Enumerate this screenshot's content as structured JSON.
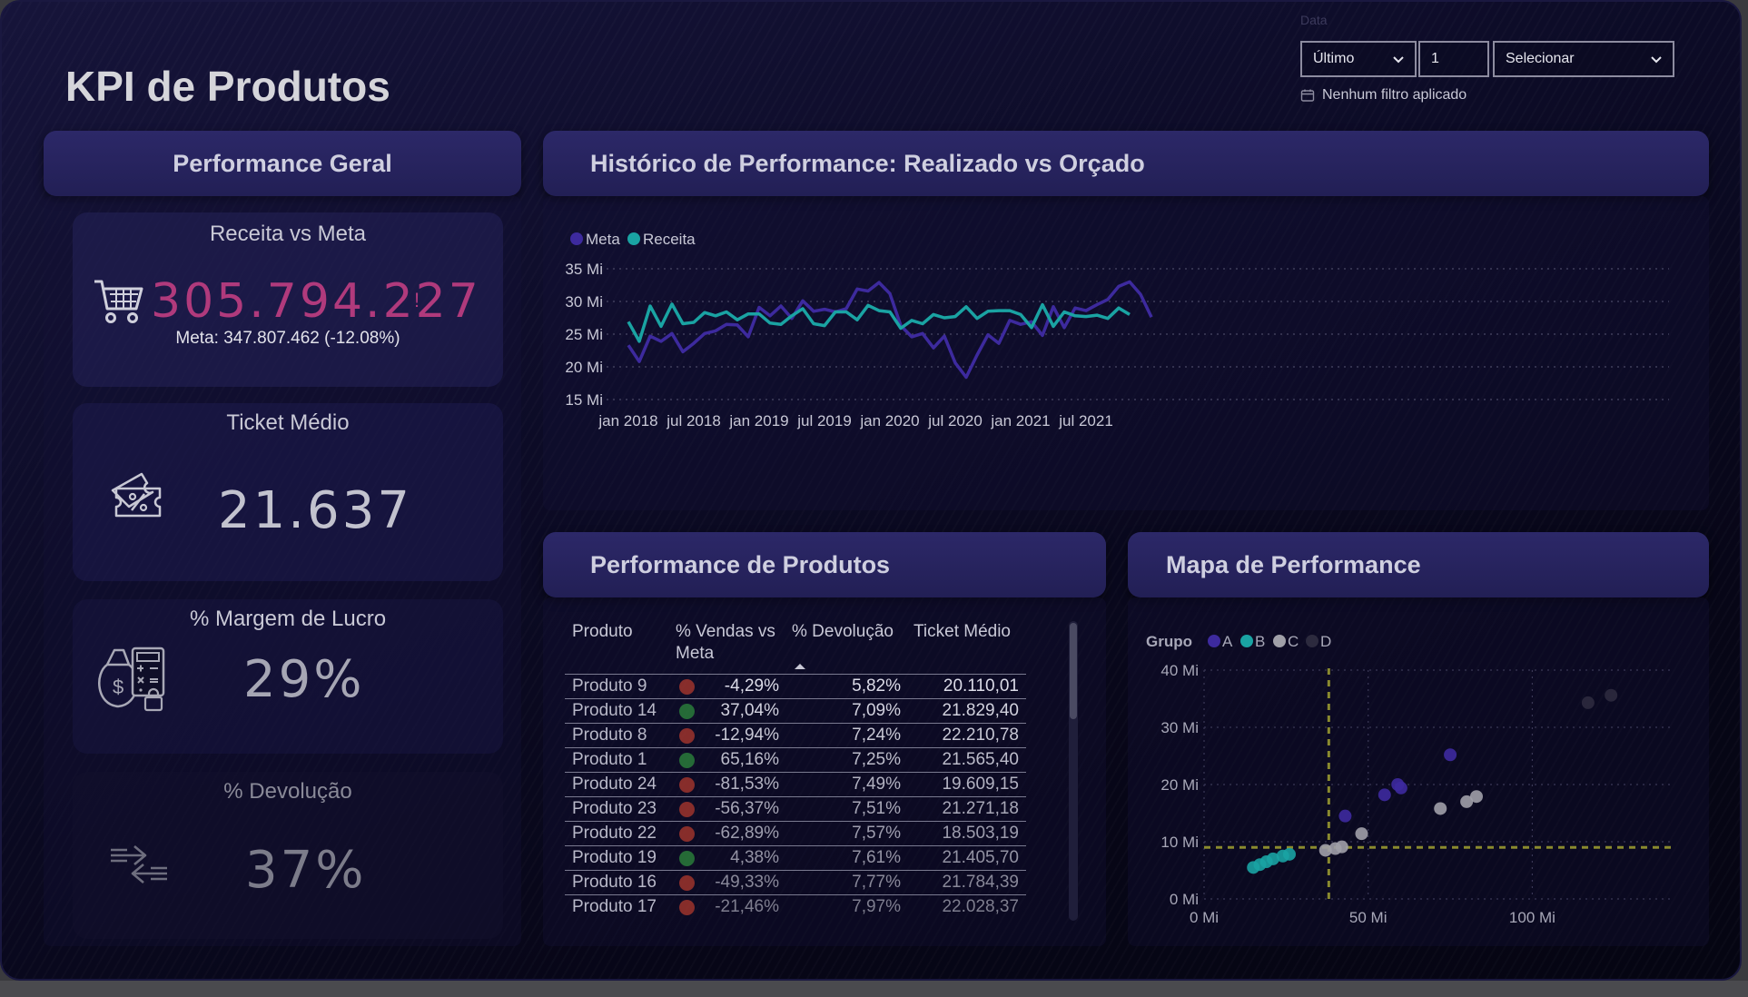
{
  "page_title": "KPI de Produtos",
  "filter": {
    "hint": "Data",
    "mode": "Último",
    "count": "1",
    "unit_placeholder": "Selecionar",
    "status": "Nenhum filtro aplicado"
  },
  "performance_geral": {
    "title": "Performance Geral",
    "receita": {
      "title": "Receita vs Meta",
      "value": "305.794.227",
      "alert": "!",
      "meta": "Meta: 347.807.462 (-12.08%)",
      "icon": "shopping-cart-icon",
      "value_color": "#b03a7c"
    },
    "ticket": {
      "title": "Ticket Médio",
      "value": "21.637",
      "icon": "discount-ticket-icon"
    },
    "margem": {
      "title": "% Margem de Lucro",
      "value": "29%",
      "icon": "money-bag-calculator-icon"
    },
    "devolucao": {
      "title": "% Devolução",
      "value": "37%",
      "icon": "exchange-arrows-icon"
    }
  },
  "historico": {
    "title": "Histórico de Performance: Realizado vs Orçado",
    "chart_data": {
      "type": "line",
      "legend_position": "top-left",
      "x_tick_labels": [
        "jan 2018",
        "jul 2018",
        "jan 2019",
        "jul 2019",
        "jan 2020",
        "jul 2020",
        "jan 2021",
        "jul 2021"
      ],
      "y_tick_labels": [
        "35 Mi",
        "30 Mi",
        "25 Mi",
        "20 Mi",
        "15 Mi"
      ],
      "ylim": [
        15,
        35
      ],
      "grid": true,
      "x_start": "jan 2018",
      "x_interval": "month",
      "series": [
        {
          "name": "Meta",
          "color": "#3d2a9e",
          "values": [
            23.3,
            20.8,
            24.7,
            23.9,
            25.1,
            22.3,
            23.6,
            25.1,
            25.5,
            26.5,
            26.4,
            24.6,
            29.1,
            27.8,
            29.3,
            27.4,
            30.1,
            28.5,
            28.8,
            28.4,
            28.9,
            31.9,
            31.6,
            32.9,
            31.2,
            26.3,
            24.6,
            25.1,
            22.9,
            24.7,
            20.6,
            18.4,
            21.8,
            24.9,
            23.6,
            27.1,
            26.5,
            26.9,
            24.8,
            29.2,
            26.0,
            29.0,
            28.6,
            29.5,
            30.3,
            32.3,
            33.0,
            31.1,
            27.6
          ]
        },
        {
          "name": "Receita",
          "color": "#1aa3a3",
          "values": [
            26.9,
            23.9,
            29.3,
            26.2,
            29.6,
            26.6,
            26.8,
            28.3,
            27.8,
            28.4,
            27.2,
            28.1,
            28.1,
            26.7,
            26.5,
            27.8,
            28.9,
            26.6,
            26.3,
            28.4,
            28.4,
            27.2,
            29.4,
            28.6,
            28.4,
            25.9,
            27.1,
            26.6,
            28.0,
            27.5,
            27.7,
            29.2,
            27.4,
            28.5,
            28.6,
            28.6,
            28.0,
            26.0,
            29.5,
            26.2,
            28.4,
            27.8,
            27.7,
            27.9,
            27.4,
            29.0,
            28.0
          ]
        }
      ]
    }
  },
  "produtos": {
    "title": "Performance de Produtos",
    "columns": [
      "Produto",
      "% Vendas vs Meta",
      "% Devolução",
      "Ticket Médio"
    ],
    "rows": [
      {
        "produto": "Produto 9",
        "status": "#b03a2e",
        "vendas": "-4,29%",
        "devolucao": "5,82%",
        "ticket": "20.110,01"
      },
      {
        "produto": "Produto 14",
        "status": "#2e8b3e",
        "vendas": "37,04%",
        "devolucao": "7,09%",
        "ticket": "21.829,40"
      },
      {
        "produto": "Produto 8",
        "status": "#b03a2e",
        "vendas": "-12,94%",
        "devolucao": "7,24%",
        "ticket": "22.210,78"
      },
      {
        "produto": "Produto 1",
        "status": "#2e8b3e",
        "vendas": "65,16%",
        "devolucao": "7,25%",
        "ticket": "21.565,40"
      },
      {
        "produto": "Produto 24",
        "status": "#b03a2e",
        "vendas": "-81,53%",
        "devolucao": "7,49%",
        "ticket": "19.609,15"
      },
      {
        "produto": "Produto 23",
        "status": "#b03a2e",
        "vendas": "-56,37%",
        "devolucao": "7,51%",
        "ticket": "21.271,18"
      },
      {
        "produto": "Produto 22",
        "status": "#b03a2e",
        "vendas": "-62,89%",
        "devolucao": "7,57%",
        "ticket": "18.503,19"
      },
      {
        "produto": "Produto 19",
        "status": "#2e8b3e",
        "vendas": "4,38%",
        "devolucao": "7,61%",
        "ticket": "21.405,70"
      },
      {
        "produto": "Produto 16",
        "status": "#b03a2e",
        "vendas": "-49,33%",
        "devolucao": "7,77%",
        "ticket": "21.784,39"
      },
      {
        "produto": "Produto 17",
        "status": "#b03a2e",
        "vendas": "-21,46%",
        "devolucao": "7,97%",
        "ticket": "22.028,37"
      }
    ]
  },
  "mapa": {
    "title": "Mapa de Performance",
    "chart_data": {
      "type": "scatter",
      "legend_title": "Grupo",
      "legend_position": "top-left",
      "x_tick_labels": [
        "0 Mi",
        "50 Mi",
        "100 Mi"
      ],
      "y_tick_labels": [
        "40 Mi",
        "30 Mi",
        "20 Mi",
        "10 Mi",
        "0 Mi"
      ],
      "xlim": [
        0,
        140
      ],
      "ylim": [
        0,
        40
      ],
      "reference_lines": {
        "x": 38,
        "y": 9
      },
      "series": [
        {
          "name": "A",
          "color": "#3d2a9e",
          "points": [
            [
              43,
              14.5
            ],
            [
              55,
              18.2
            ],
            [
              59,
              20.0
            ],
            [
              60,
              19.4
            ],
            [
              75,
              25.2
            ]
          ]
        },
        {
          "name": "B",
          "color": "#1aa3a3",
          "points": [
            [
              15,
              5.5
            ],
            [
              17,
              6.0
            ],
            [
              19,
              6.5
            ],
            [
              21,
              7.0
            ],
            [
              24,
              7.5
            ],
            [
              26,
              7.8
            ]
          ]
        },
        {
          "name": "C",
          "color": "#a0a0a8",
          "points": [
            [
              37,
              8.5
            ],
            [
              40,
              8.8
            ],
            [
              42,
              9.1
            ],
            [
              48,
              11.4
            ],
            [
              72,
              15.8
            ],
            [
              80,
              17.0
            ],
            [
              83,
              17.9
            ]
          ]
        },
        {
          "name": "D",
          "color": "#2c2a3e",
          "points": [
            [
              117,
              34.3
            ],
            [
              124,
              35.6
            ]
          ]
        }
      ]
    }
  }
}
